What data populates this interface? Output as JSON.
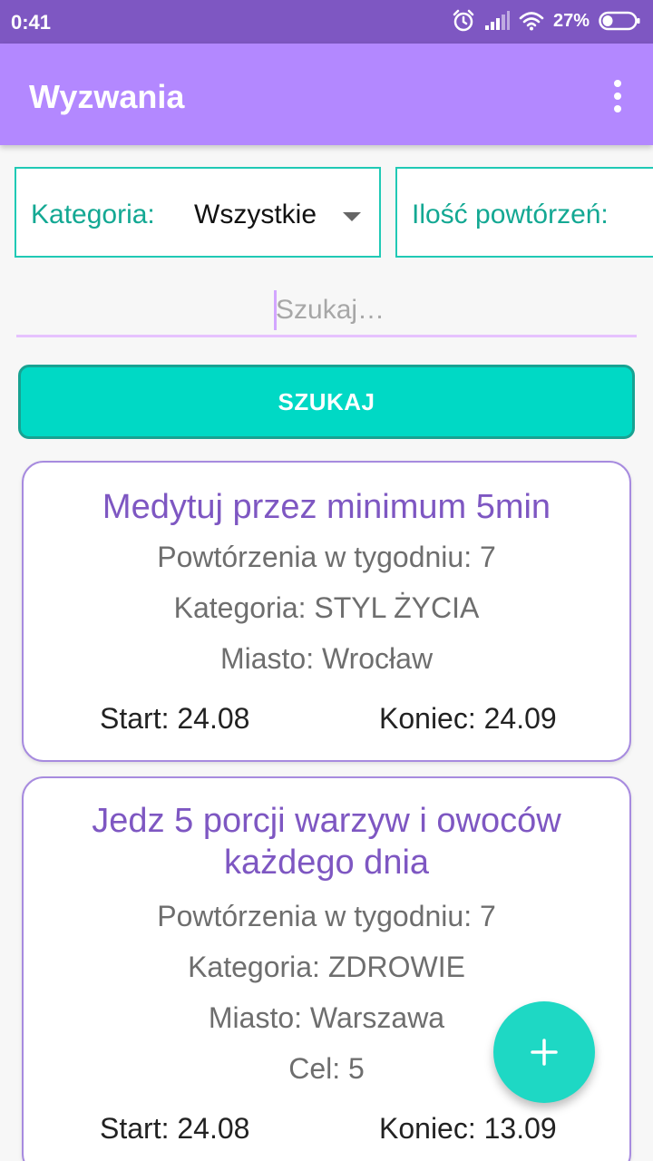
{
  "status_bar": {
    "time": "0:41",
    "battery_percent": "27%",
    "icons": [
      "alarm-icon",
      "signal-icon",
      "wifi-icon",
      "battery-icon"
    ]
  },
  "app_bar": {
    "title": "Wyzwania",
    "menu_icon": "overflow-menu-icon"
  },
  "filters": {
    "category_label": "Kategoria:",
    "category_value": "Wszystkie",
    "repetitions_label": "Ilość powtórzeń:"
  },
  "search": {
    "placeholder": "Szukaj…",
    "button_label": "SZUKAJ"
  },
  "challenges": [
    {
      "title": "Medytuj przez minimum 5min",
      "repetitions": "Powtórzenia w tygodniu: 7",
      "category": "Kategoria: STYL ŻYCIA",
      "city": "Miasto: Wrocław",
      "start": "Start: 24.08",
      "end": "Koniec: 24.09"
    },
    {
      "title_line1": "Jedz 5 porcji warzyw i owoców",
      "title_line2": "każdego dnia",
      "repetitions": "Powtórzenia w tygodniu: 7",
      "category": "Kategoria: ZDROWIE",
      "city": "Miasto: Warszawa",
      "goal": "Cel: 5",
      "start": "Start: 24.08",
      "end": "Koniec: 13.09"
    }
  ],
  "fab": {
    "icon": "plus-icon",
    "color": "#1ed8c4"
  },
  "colors": {
    "status_bar": "#7e57c2",
    "app_bar": "#b388ff",
    "accent": "#00d9c5",
    "title_purple": "#7e57c2"
  }
}
